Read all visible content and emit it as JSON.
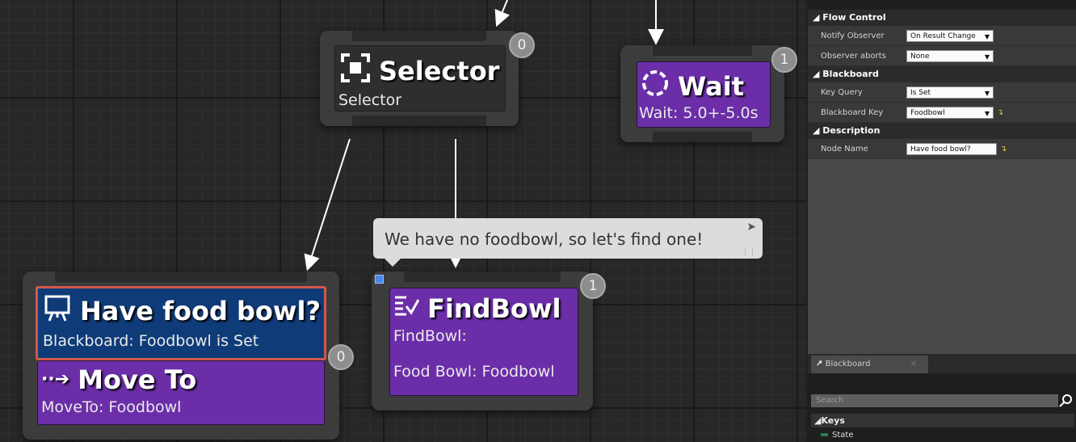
{
  "graph": {
    "selector_node": {
      "title": "Selector",
      "subtitle": "Selector",
      "badge": "0"
    },
    "wait_node": {
      "title": "Wait",
      "subtitle": "Wait: 5.0+-5.0s",
      "badge": "1"
    },
    "have_food_bowl_node": {
      "decorator_title": "Have food bowl?",
      "decorator_subtitle": "Blackboard: Foodbowl is Set",
      "badge": "0"
    },
    "move_to_node": {
      "title": "Move To",
      "subtitle": "MoveTo: Foodbowl"
    },
    "findbowl_node": {
      "title": "FindBowl",
      "subtitle_line1": "FindBowl:",
      "subtitle_line2": "Food Bowl: Foodbowl",
      "badge": "1"
    },
    "comment": "We have no foodbowl, so let's find one!"
  },
  "details": {
    "sections": {
      "flow_control": "Flow Control",
      "blackboard": "Blackboard",
      "description": "Description"
    },
    "notify_observer": {
      "label": "Notify Observer",
      "value": "On Result Change"
    },
    "observer_aborts": {
      "label": "Observer aborts",
      "value": "None"
    },
    "key_query": {
      "label": "Key Query",
      "value": "Is Set"
    },
    "blackboard_key": {
      "label": "Blackboard Key",
      "value": "Foodbowl"
    },
    "node_name": {
      "label": "Node Name",
      "value": "Have food bowl?"
    }
  },
  "blackboard_panel": {
    "tab_label": "Blackboard",
    "search_placeholder": "Search",
    "keys_header": "Keys",
    "keys": [
      "State"
    ]
  }
}
